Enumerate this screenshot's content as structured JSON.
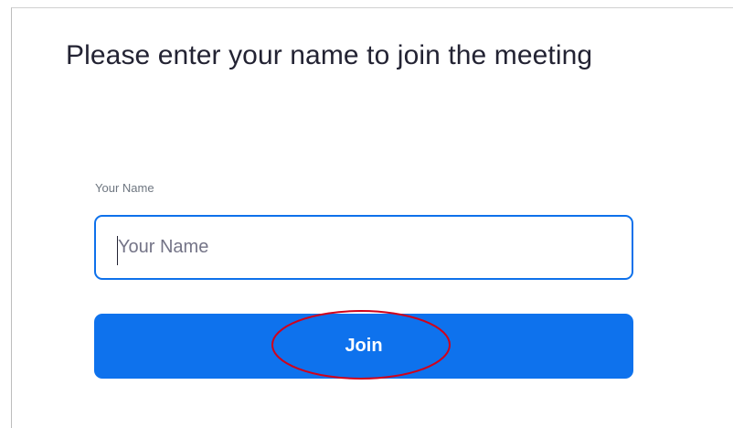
{
  "page": {
    "title": "Please enter your name to join the meeting"
  },
  "form": {
    "name_label": "Your Name",
    "name_value": "",
    "name_placeholder": "Your Name",
    "join_label": "Join"
  },
  "annotation": {
    "shape": "ellipse",
    "color": "#d0021b",
    "target": "join-button"
  },
  "colors": {
    "accent": "#0e72ed",
    "input_border": "#0e71eb",
    "title_text": "#232333"
  }
}
